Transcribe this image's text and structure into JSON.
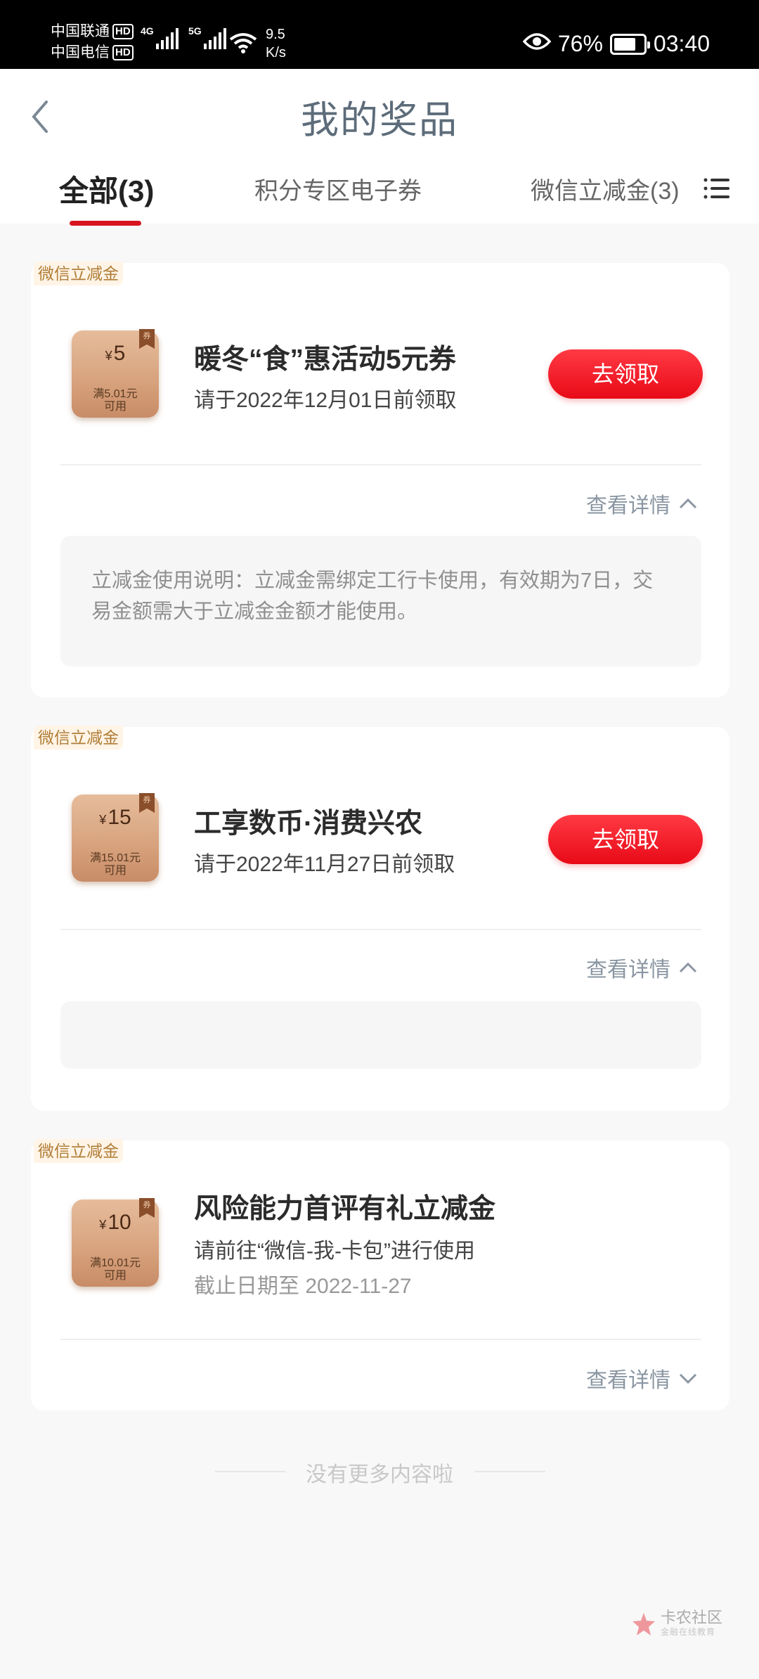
{
  "status_bar": {
    "carrier1": "中国联通",
    "carrier2": "中国电信",
    "hd": "HD",
    "net1": "4G",
    "net2": "5G",
    "speed_value": "9.5",
    "speed_unit": "K/s",
    "battery": "76%",
    "time": "03:40"
  },
  "header": {
    "title": "我的奖品"
  },
  "tabs": [
    {
      "label": "全部(3)",
      "active": true
    },
    {
      "label": "积分专区电子券",
      "active": false
    },
    {
      "label": "微信立减金(3)",
      "active": false
    }
  ],
  "cards": [
    {
      "tag": "微信立减金",
      "coupon": {
        "currency": "¥",
        "amount": "5",
        "line1": "满5.01元",
        "line2": "可用",
        "ribbon": "券"
      },
      "title": "暖冬“食”惠活动5元券",
      "subtitle": "请于2022年12月01日前领取",
      "button": "去领取",
      "details_label": "查看详情",
      "expanded": true,
      "description": "立减金使用说明：立减金需绑定工行卡使用，有效期为7日，交易金额需大于立减金金额才能使用。"
    },
    {
      "tag": "微信立减金",
      "coupon": {
        "currency": "¥",
        "amount": "15",
        "line1": "满15.01元",
        "line2": "可用",
        "ribbon": "券"
      },
      "title": "工享数币·消费兴农",
      "subtitle": "请于2022年11月27日前领取",
      "button": "去领取",
      "details_label": "查看详情",
      "expanded": true,
      "description": ""
    },
    {
      "tag": "微信立减金",
      "coupon": {
        "currency": "¥",
        "amount": "10",
        "line1": "满10.01元",
        "line2": "可用",
        "ribbon": "券"
      },
      "title": "风险能力首评有礼立减金",
      "subtitle": "请前往“微信-我-卡包”进行使用",
      "subtitle2": "截止日期至 2022-11-27",
      "details_label": "查看详情",
      "expanded": false
    }
  ],
  "footer": {
    "no_more": "没有更多内容啦"
  },
  "watermark": {
    "name": "卡农社区",
    "tagline": "金融在线教育"
  },
  "colors": {
    "accent_red": "#e80a17",
    "tag_bg": "#fff4e6",
    "tag_text": "#b07d37"
  }
}
